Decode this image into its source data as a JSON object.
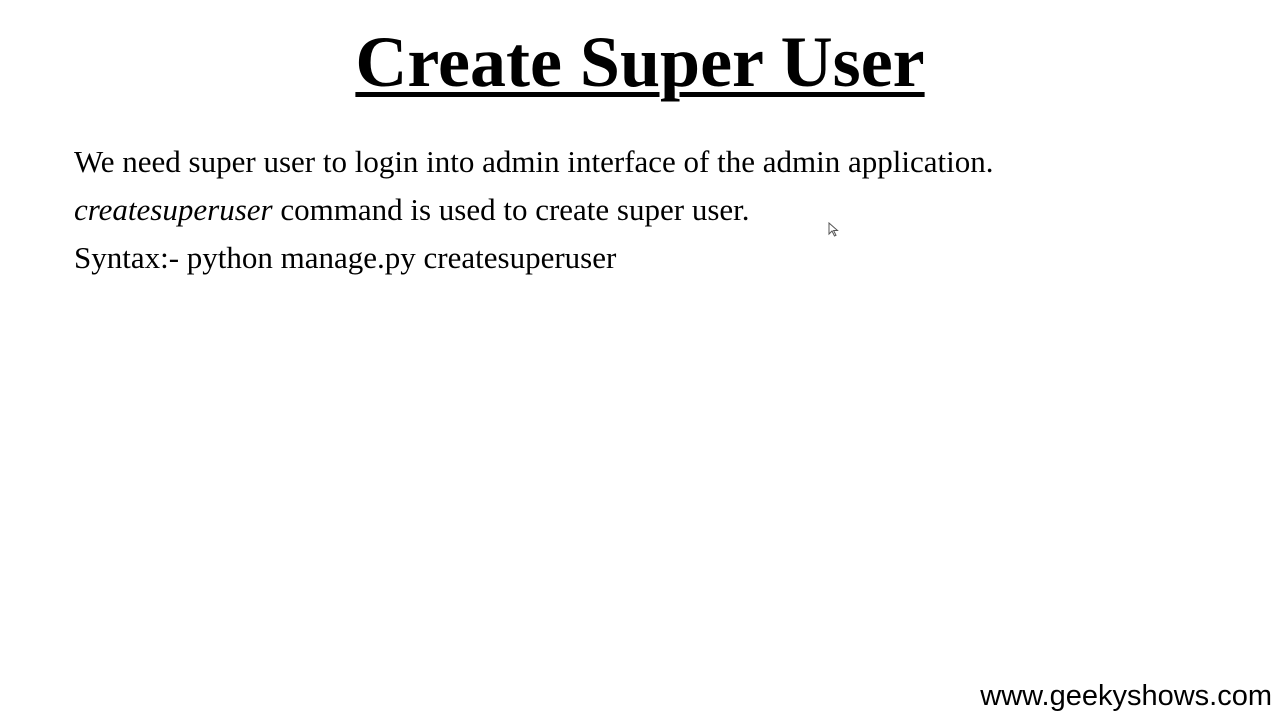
{
  "slide": {
    "title": "Create Super User",
    "lines": [
      {
        "text": "We need super user to login into admin interface of the admin application."
      },
      {
        "emphasis": "createsuperuser",
        "text": " command is used to create super user."
      },
      {
        "text": "Syntax:- python manage.py createsuperuser"
      }
    ],
    "footer_url": "www.geekyshows.com"
  },
  "cursor_icon": "mouse-pointer-icon"
}
